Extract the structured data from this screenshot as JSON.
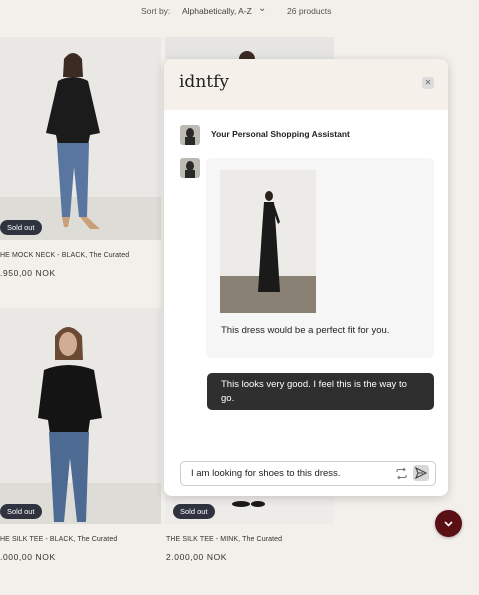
{
  "sort": {
    "label": "Sort by:",
    "value": "Alphabetically, A-Z",
    "count": "26 products"
  },
  "products": [
    {
      "title": "HE MOCK NECK - BLACK, The Curated",
      "price": ".950,00 NOK",
      "badge": "Sold out"
    },
    {
      "title": "HE SILK TEE - BLACK, The Curated",
      "price": ".000,00 NOK",
      "badge": "Sold out"
    },
    {
      "title": "THE SILK TEE - MINK, The Curated",
      "price": "2.000,00 NOK",
      "badge": "Sold out"
    }
  ],
  "chat": {
    "brand": "idntfy",
    "close_icon": "close-icon",
    "assistant_name": "Your Personal Shopping Assistant",
    "bot_message": "This dress would be a perfect fit for you.",
    "user_message": "This looks very good. I feel this is the way to go.",
    "input_value": "I am looking for shoes to this dress.",
    "icons": {
      "refresh": "refresh-icon",
      "send": "send-icon"
    }
  },
  "scroll_button": {
    "icon": "chevron-down-icon",
    "color": "#5a0f14"
  }
}
